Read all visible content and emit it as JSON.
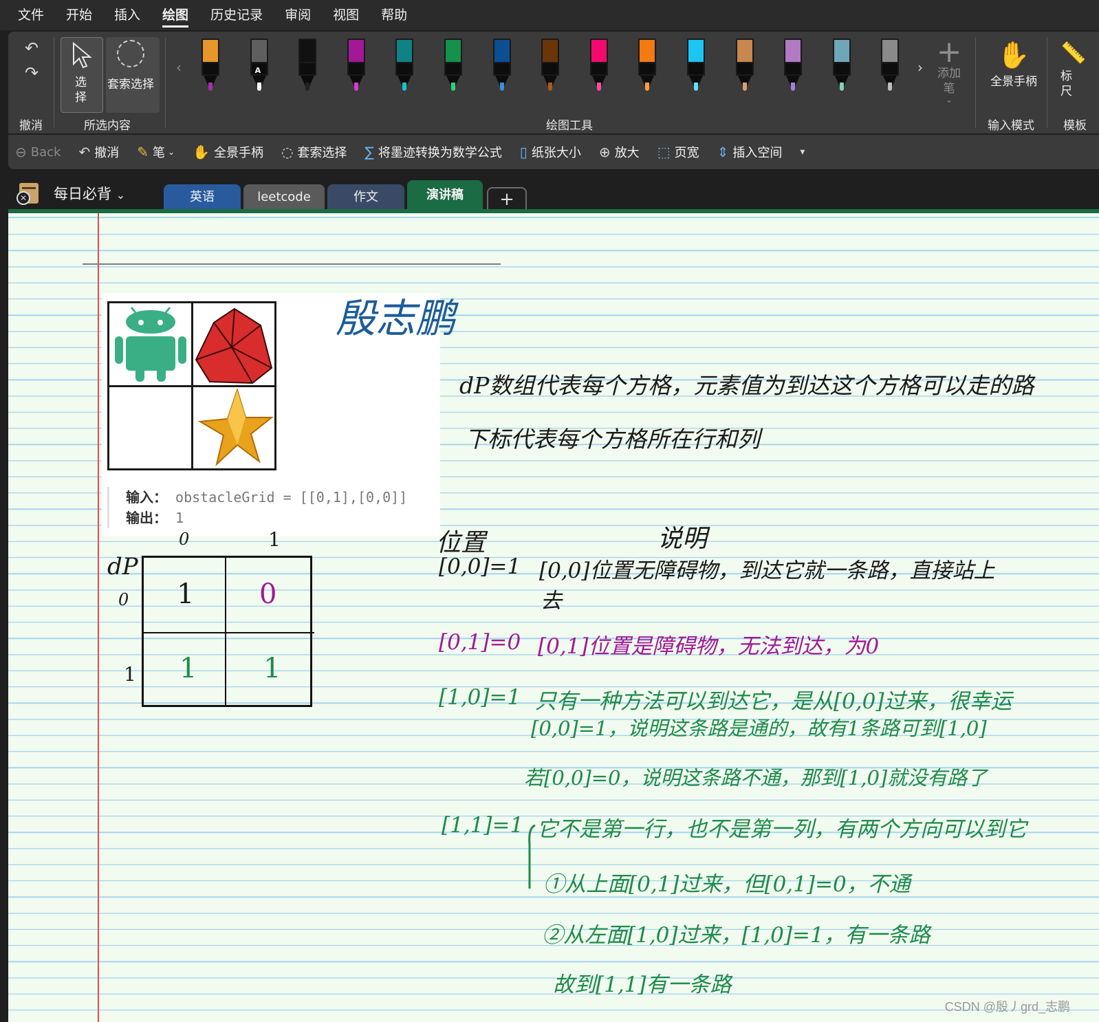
{
  "menu": [
    "文件",
    "开始",
    "插入",
    "绘图",
    "历史记录",
    "审阅",
    "视图",
    "帮助"
  ],
  "menu_active_index": 3,
  "ribbon": {
    "undo_group_label": "撤消",
    "select_label": "选择",
    "lasso_label": "套索选择",
    "selection_group_label": "所选内容",
    "drawing_tools_label": "绘图工具",
    "add_pen_label": "添加笔",
    "add_pen_chevron": "⌄",
    "full_hand_label": "全景手柄",
    "input_mode_label": "输入模式",
    "ruler_label": "标尺",
    "template_group_label": "模板",
    "pen_text_glyph": "A",
    "pens": [
      {
        "color": "#e7962a",
        "nib": "#a42fb1"
      },
      {
        "color": "#5f5f5f",
        "nib": "#ffffff",
        "glyph": true
      },
      {
        "color": "#111111",
        "nib": "#222222"
      },
      {
        "color": "#a21896",
        "nib": "#d83bc9"
      },
      {
        "color": "#0e8285",
        "nib": "#17c1cc"
      },
      {
        "color": "#14914a",
        "nib": "#2ad179"
      },
      {
        "color": "#0b4f91",
        "nib": "#3b8ee0"
      },
      {
        "color": "#6b3508",
        "nib": "#a55a1a"
      },
      {
        "color": "#f40a6e",
        "nib": "#ff4b97"
      },
      {
        "color": "#f47a12",
        "nib": "#ff9c3d"
      },
      {
        "color": "#1cc4f2",
        "nib": "#63dcff"
      },
      {
        "color": "#c7874d",
        "nib": "#d9a070"
      },
      {
        "color": "#b27ac4",
        "nib": "#a67ee0"
      },
      {
        "color": "#6fa7b8",
        "nib": "#7fd0b8"
      },
      {
        "color": "#8a8a8a",
        "nib": "#bdbdbd"
      }
    ]
  },
  "qat": {
    "back": "Back",
    "undo": "撤消",
    "pen": "笔",
    "pen_chevron": "⌄",
    "hand": "全景手柄",
    "lasso": "套索选择",
    "ink_to_math": "将墨迹转换为数学公式",
    "paper_size": "纸张大小",
    "zoom": "放大",
    "page_width": "页宽",
    "insert_space": "插入空间",
    "overflow": "▾"
  },
  "notebook": {
    "name": "每日必背",
    "chevron": "⌄",
    "close_glyph": "✕",
    "tabs": [
      {
        "label": "英语",
        "color": "#2a5a9e"
      },
      {
        "label": "leetcode",
        "color": "#5a5a5a"
      },
      {
        "label": "作文",
        "color": "#3a4a66"
      },
      {
        "label": "演讲稿",
        "color": "#1b6b45"
      }
    ],
    "add_tab": "+",
    "active_tab_index": 3
  },
  "page": {
    "author_signature": "殷志鹏",
    "example": {
      "input_label": "输入：",
      "input_value": "obstacleGrid = [[0,1],[0,0]]",
      "output_label": "输出：",
      "output_value": "1"
    },
    "dp_table": {
      "name": "dP",
      "col_headers": [
        "0",
        "1"
      ],
      "row_headers": [
        "0",
        "1"
      ],
      "cells": [
        [
          "1",
          "0"
        ],
        [
          "1",
          "1"
        ]
      ]
    },
    "notes": {
      "line1": "dP数组代表每个方格，元素值为到达这个方格可以走的路",
      "line2": "下标代表每个方格所在行和列",
      "col_position": "位置",
      "col_explain": "说明",
      "r1_pos": "[0,0]=1",
      "r1_text": "[0,0]位置无障碍物，到达它就一条路，直接站上",
      "r1_text2": "去",
      "r2_pos": "[0,1]=0",
      "r2_text": "[0,1]位置是障碍物，无法到达，为0",
      "r3_pos": "[1,0]=1",
      "r3_text": "只有一种方法可以到达它，是从[0,0]过来，很幸运",
      "r3_text2": "[0,0]=1，说明这条路是通的，故有1条路可到[1,0]",
      "r3_text3": "若[0,0]=0，说明这条路不通，那到[1,0]就没有路了",
      "r4_pos": "[1,1]=1",
      "r4_text": "它不是第一行，也不是第一列，有两个方向可以到它",
      "r4_sub1": "①从上面[0,1]过来，但[0,1]=0，不通",
      "r4_sub2": "②从左面[1,0]过来，[1,0]=1，有一条路",
      "r4_sub3": "故到[1,1]有一条路"
    },
    "watermark": "CSDN @殷丿grd_志鹏"
  },
  "colors": {
    "accent_green": "#1b6b45",
    "ink_black": "#1a1a1a",
    "ink_magenta": "#a21896",
    "ink_green": "#1d8a4c",
    "ink_blue": "#1b5c9a",
    "margin_red": "#e64a4a",
    "rule_blue": "#a6d4ef"
  }
}
